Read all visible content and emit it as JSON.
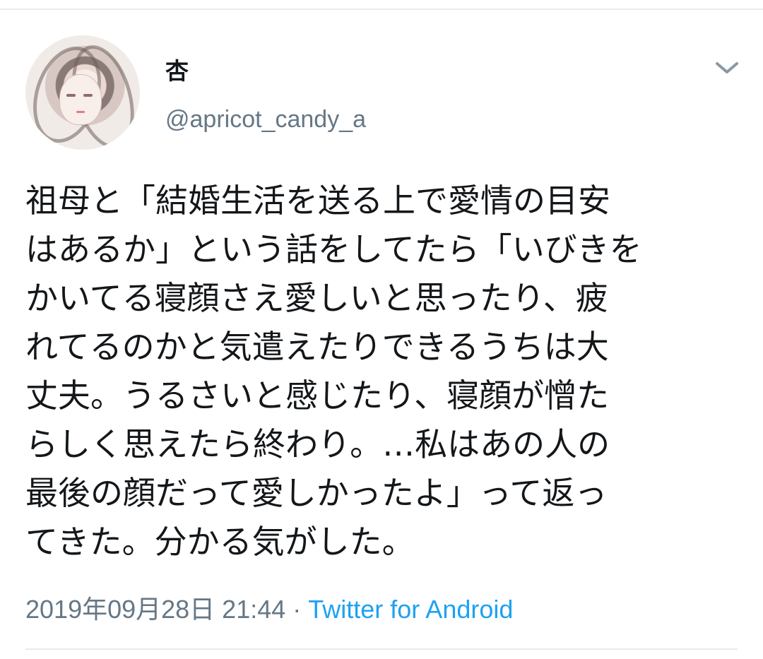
{
  "tweet": {
    "display_name": "杏",
    "handle": "@apricot_candy_a",
    "text_lines": [
      "祖母と「結婚生活を送る上で愛情の目安",
      "はあるか」という話をしてたら「いびきを",
      "かいてる寝顔さえ愛しいと思ったり、疲",
      "れてるのかと気遣えたりできるうちは大",
      "丈夫。うるさいと感じたり、寝顔が憎た",
      "らしく思えたら終わり。…私はあの人の",
      "最後の顔だって愛しかったよ」って返っ",
      "てきた。分かる気がした。"
    ],
    "timestamp": "2019年09月28日 21:44",
    "separator": " · ",
    "source": "Twitter for Android"
  },
  "icons": {
    "menu": "chevron-down-icon",
    "avatar": "profile-avatar"
  },
  "colors": {
    "text": "#14171a",
    "secondary": "#657786",
    "link": "#1da1f2",
    "divider": "#e6ecf0"
  }
}
